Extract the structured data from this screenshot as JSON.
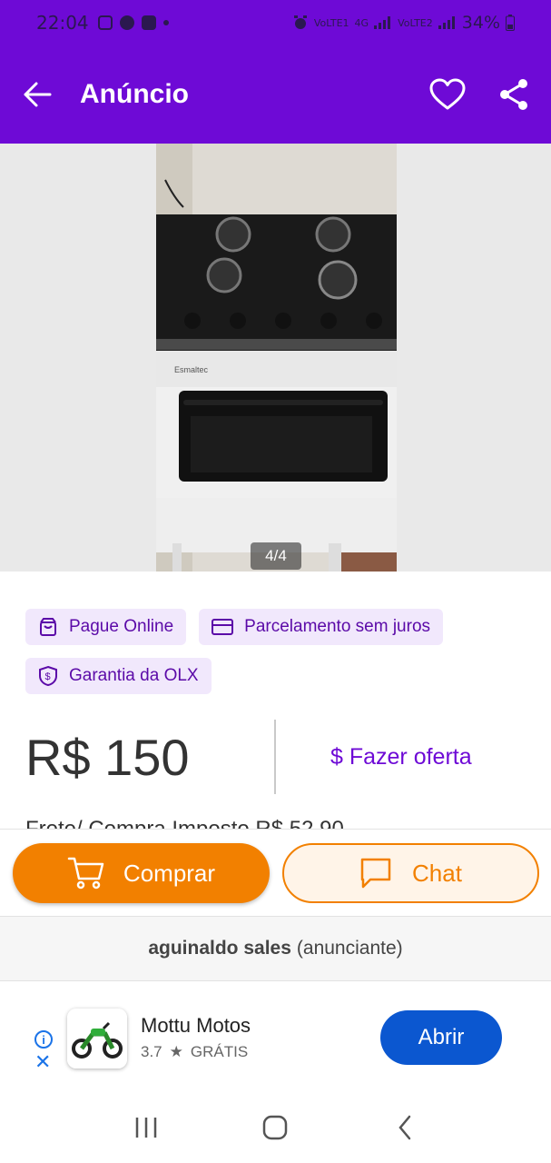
{
  "status_bar": {
    "time": "22:04",
    "network_labels": [
      "VoLTE1",
      "4G",
      "VoLTE2"
    ],
    "battery": "34%"
  },
  "app_bar": {
    "title": "Anúncio",
    "icons": [
      "back-arrow-icon",
      "heart-icon",
      "share-icon"
    ]
  },
  "gallery": {
    "counter": "4/4",
    "brand_text": "Esmaltec"
  },
  "badges": [
    {
      "label": "Pague Online",
      "icon": "bag-icon"
    },
    {
      "label": "Parcelamento sem juros",
      "icon": "card-icon"
    },
    {
      "label": "Garantia da OLX",
      "icon": "shield-dollar-icon"
    }
  ],
  "price": {
    "value": "R$ 150",
    "offer_label": "$ Fazer oferta"
  },
  "partial_text": "Frete/ Compra Imposto R$ 52,90",
  "actions": {
    "buy_label": "Comprar",
    "chat_label": "Chat"
  },
  "seller": {
    "name": "aguinaldo sales",
    "role": "(anunciante)"
  },
  "ad": {
    "app_name": "Mottu Motos",
    "rating": "3.7",
    "price_tag": "GRÁTIS",
    "cta": "Abrir"
  },
  "colors": {
    "brand_purple": "#6e0ad6",
    "orange": "#f28000",
    "badge_bg": "#f1e8fc",
    "ad_blue": "#0b57d0"
  }
}
